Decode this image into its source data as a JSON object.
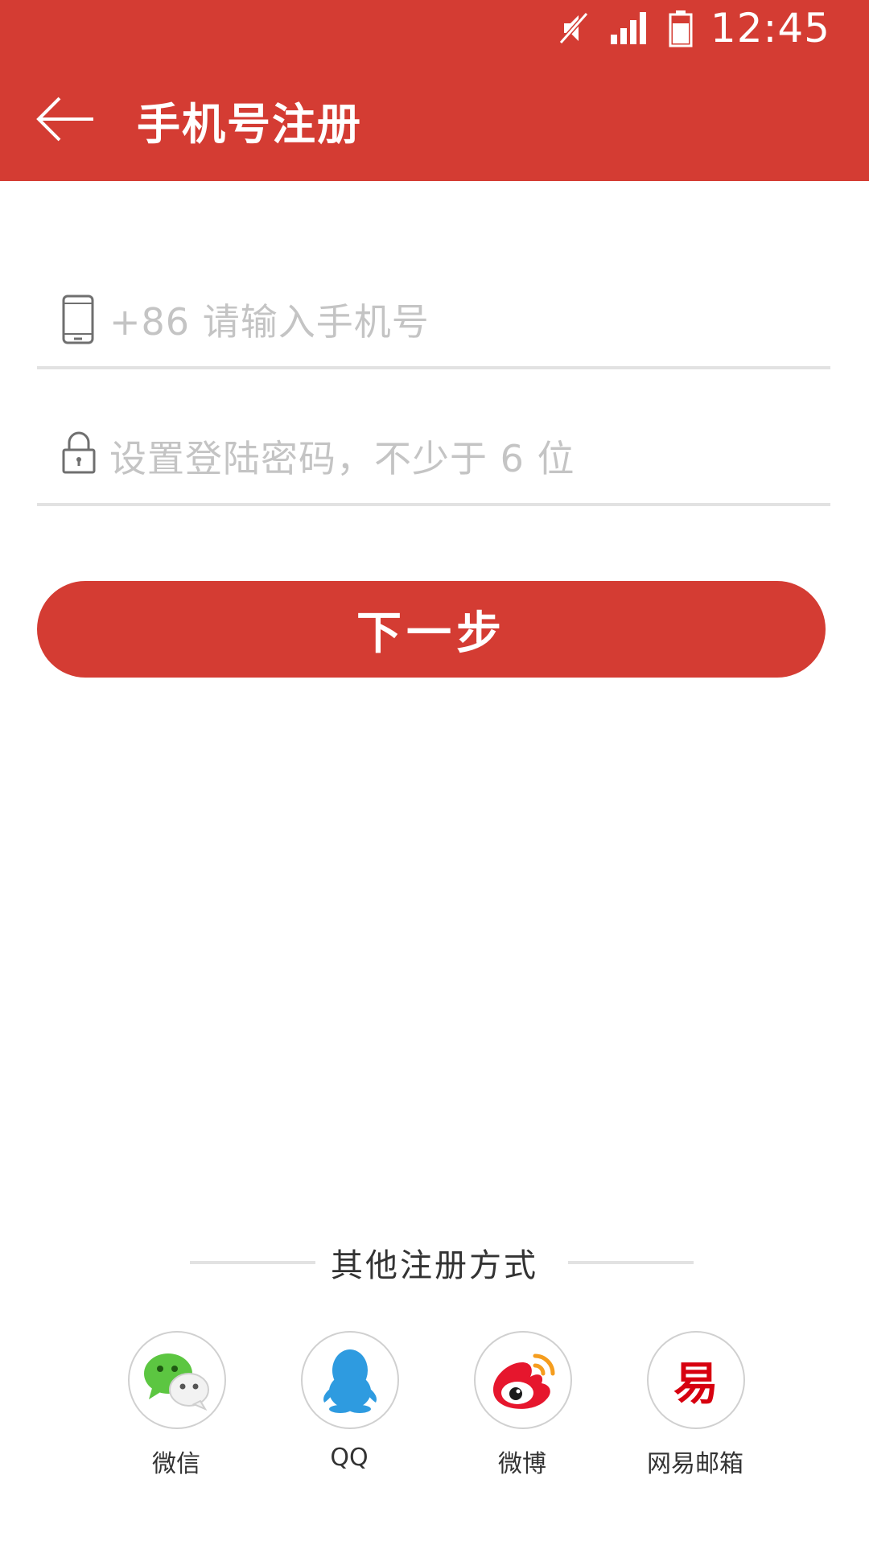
{
  "status_bar": {
    "time": "12:45",
    "icons": [
      "mute-icon",
      "signal-icon",
      "battery-icon"
    ]
  },
  "appbar": {
    "back_icon": "back-arrow-icon",
    "title": "手机号注册"
  },
  "form": {
    "phone": {
      "icon": "phone-icon",
      "value": "",
      "placeholder": "+86 请输入手机号"
    },
    "password": {
      "icon": "lock-icon",
      "value": "",
      "placeholder": "设置登陆密码，不少于 6 位"
    },
    "next_label": "下一步"
  },
  "other_methods": {
    "title": "其他注册方式",
    "items": [
      {
        "label": "微信",
        "icon": "wechat-icon"
      },
      {
        "label": "QQ",
        "icon": "qq-icon"
      },
      {
        "label": "微博",
        "icon": "weibo-icon"
      },
      {
        "label": "网易邮箱",
        "icon": "netease-mail-icon",
        "glyph": "易"
      }
    ]
  },
  "colors": {
    "primary": "#d43c33",
    "divider": "#e2e2e2",
    "placeholder": "#c4c4c4",
    "wechat_green": "#5cc641",
    "qq_blue": "#2e9be0",
    "weibo_red": "#e6162d",
    "netease_red": "#d7000f"
  }
}
